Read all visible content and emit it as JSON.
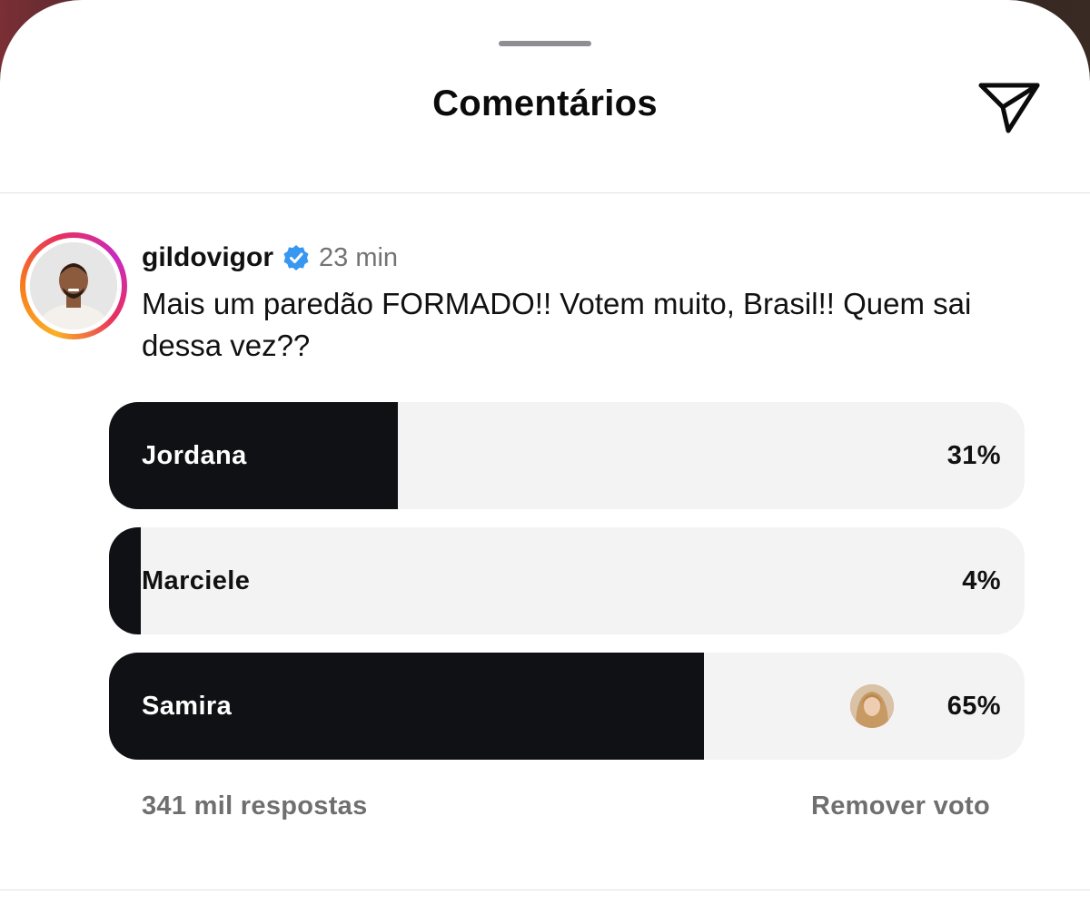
{
  "header": {
    "title": "Comentários",
    "share_icon": "send-paper-plane-icon"
  },
  "comment": {
    "username": "gildovigor",
    "verified": true,
    "time": "23 min",
    "text": "Mais um paredão FORMADO!! Votem muito, Brasil!! Quem sai dessa vez??"
  },
  "poll": {
    "options": [
      {
        "label": "Jordana",
        "percent_text": "31%",
        "percent": 31,
        "fill_fraction": 0.315
      },
      {
        "label": "Marciele",
        "percent_text": "4%",
        "percent": 4,
        "fill_fraction": 0.035
      },
      {
        "label": "Samira",
        "percent_text": "65%",
        "percent": 65,
        "fill_fraction": 0.65,
        "has_voter_avatar": true
      }
    ],
    "responses": "341 mil respostas",
    "remove_vote": "Remover voto"
  },
  "colors": {
    "poll_fill": "#0f1115",
    "poll_bg": "#f3f3f3",
    "muted_text": "#6f6f6f",
    "verified_blue": "#3897f0"
  }
}
